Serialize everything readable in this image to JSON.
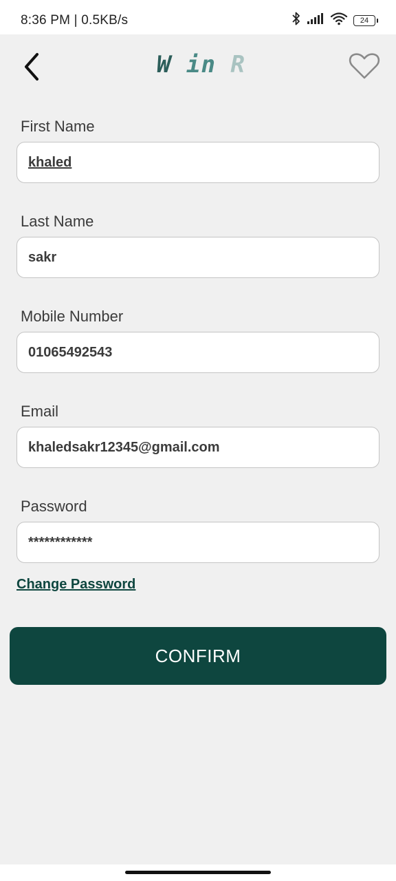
{
  "status_bar": {
    "time": "8:36 PM | 0.5KB/s",
    "battery_level": "24",
    "icons": [
      "bluetooth-icon",
      "signal-icon",
      "wifi-icon",
      "battery-icon"
    ]
  },
  "header": {
    "logo": {
      "part1": "W",
      "part2": "in",
      "part3": "R"
    },
    "back_icon": "chevron-left-icon",
    "favorite_icon": "heart-outline-icon"
  },
  "form": {
    "first_name": {
      "label": "First Name",
      "value": "khaled"
    },
    "last_name": {
      "label": "Last Name",
      "value": "sakr"
    },
    "mobile": {
      "label": "Mobile Number",
      "value": "01065492543"
    },
    "email": {
      "label": "Email",
      "value": "khaledsakr12345@gmail.com"
    },
    "password": {
      "label": "Password",
      "value": "************"
    }
  },
  "change_password_label": "Change Password",
  "confirm_label": "CONFIRM",
  "colors": {
    "primary": "#0e463f",
    "background": "#f0f0f0",
    "input_border": "#c4c4c4"
  }
}
